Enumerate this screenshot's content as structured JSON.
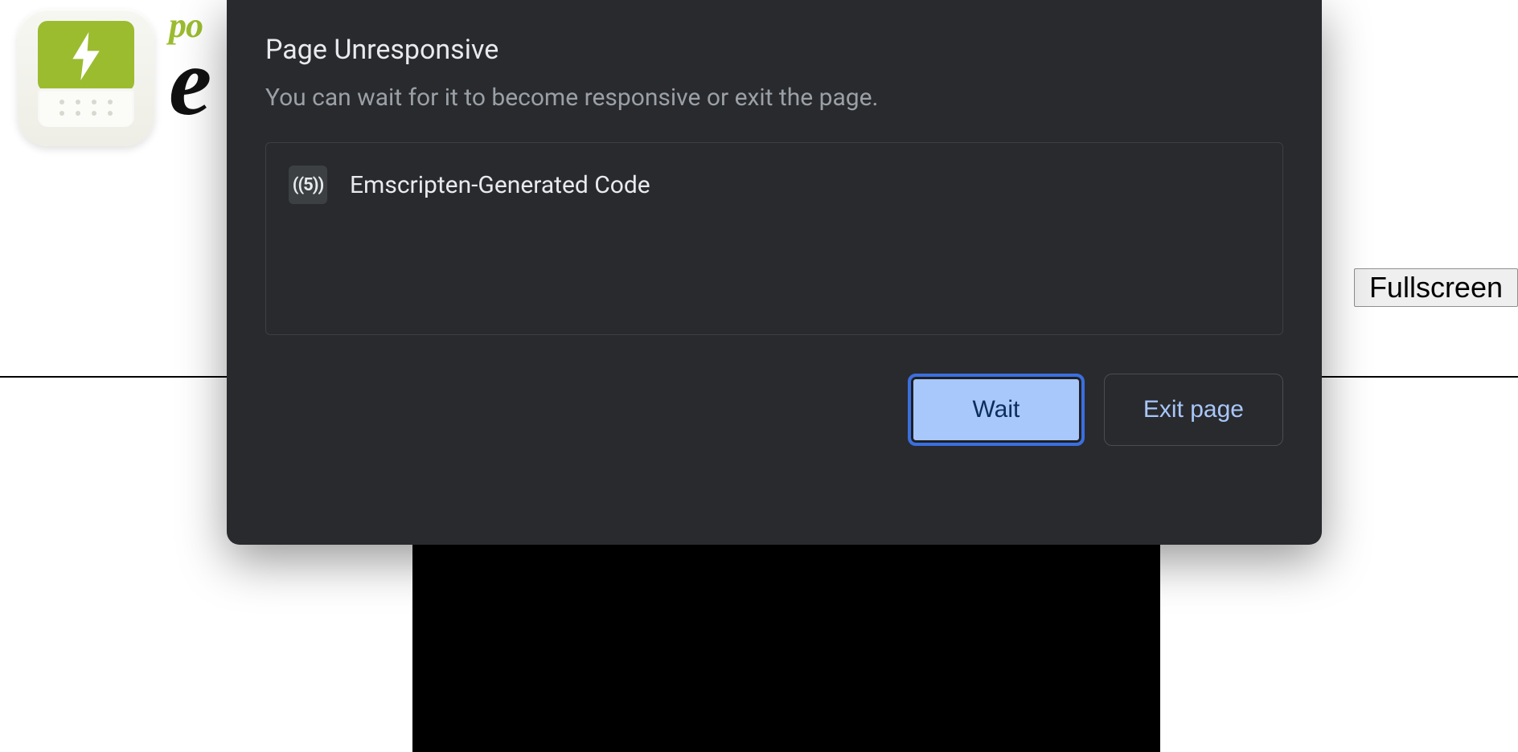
{
  "page": {
    "brand_top": "po",
    "brand_bottom": "e",
    "fullscreen_label": "Fullscreen"
  },
  "dialog": {
    "title": "Page Unresponsive",
    "description": "You can wait for it to become responsive or exit the page.",
    "process": {
      "favicon_text": "((5))",
      "name": "Emscripten-Generated Code"
    },
    "buttons": {
      "wait": "Wait",
      "exit": "Exit page"
    }
  }
}
